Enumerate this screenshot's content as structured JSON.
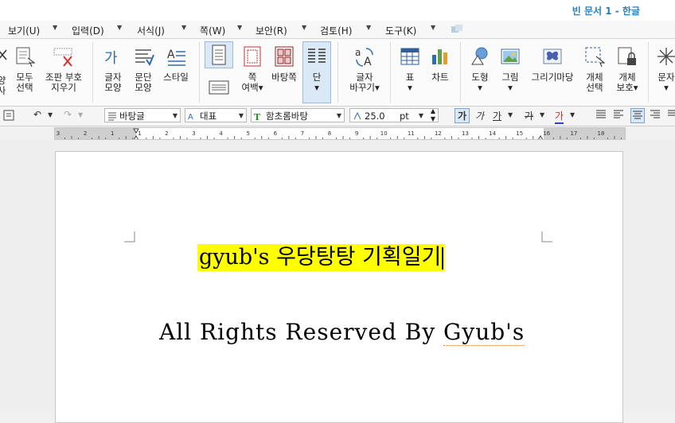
{
  "window": {
    "title": "빈 문서 1 - 한글"
  },
  "menu": [
    {
      "label": "보기(U)"
    },
    {
      "label": "입력(D)"
    },
    {
      "label": "서식(J)"
    },
    {
      "label": "쪽(W)"
    },
    {
      "label": "보안(R)"
    },
    {
      "label": "검토(H)"
    },
    {
      "label": "도구(K)"
    }
  ],
  "ribbon": {
    "cut_partial_line1": "양",
    "cut_partial_line2": "사",
    "select_all_line1": "모두",
    "select_all_line2": "선택",
    "clear_marks_line1": "조판 부호",
    "clear_marks_line2": "지우기",
    "char_shape_line1": "글자",
    "char_shape_line2": "모양",
    "para_shape_line1": "문단",
    "para_shape_line2": "모양",
    "style_label": "스타일",
    "page_margin_line1": "쪽",
    "page_margin_line2": "여백",
    "background_page": "바탕쪽",
    "columns": "단",
    "char_change_line1": "글자",
    "char_change_line2": "바꾸기",
    "table": "표",
    "chart": "차트",
    "shape": "도형",
    "picture": "그림",
    "drawing_wizard": "그리기마당",
    "object_select_line1": "개체",
    "object_select_line2": "선택",
    "object_protect_line1": "개체",
    "object_protect_line2": "보호",
    "textbox_partial": "문자"
  },
  "format_bar": {
    "style": "바탕글",
    "language": "대표",
    "font": "함초롬바탕",
    "size": "25.0",
    "unit": "pt",
    "bold": "가",
    "italic": "가",
    "underline": "가",
    "strike": "가",
    "font_color": "가"
  },
  "ruler": {
    "labels": [
      "3",
      "2",
      "1",
      "1",
      "2",
      "3",
      "4",
      "5",
      "6",
      "7",
      "8",
      "9",
      "10",
      "11",
      "12",
      "13",
      "14",
      "15",
      "16",
      "17",
      "18"
    ]
  },
  "document": {
    "title_text": "gyub's 우당탕탕 기획일기",
    "subtitle_prefix": "All Rights Reserved By ",
    "subtitle_name": "Gyub's"
  },
  "colors": {
    "highlight": "#ffff00",
    "accent": "#2a7fc0"
  }
}
